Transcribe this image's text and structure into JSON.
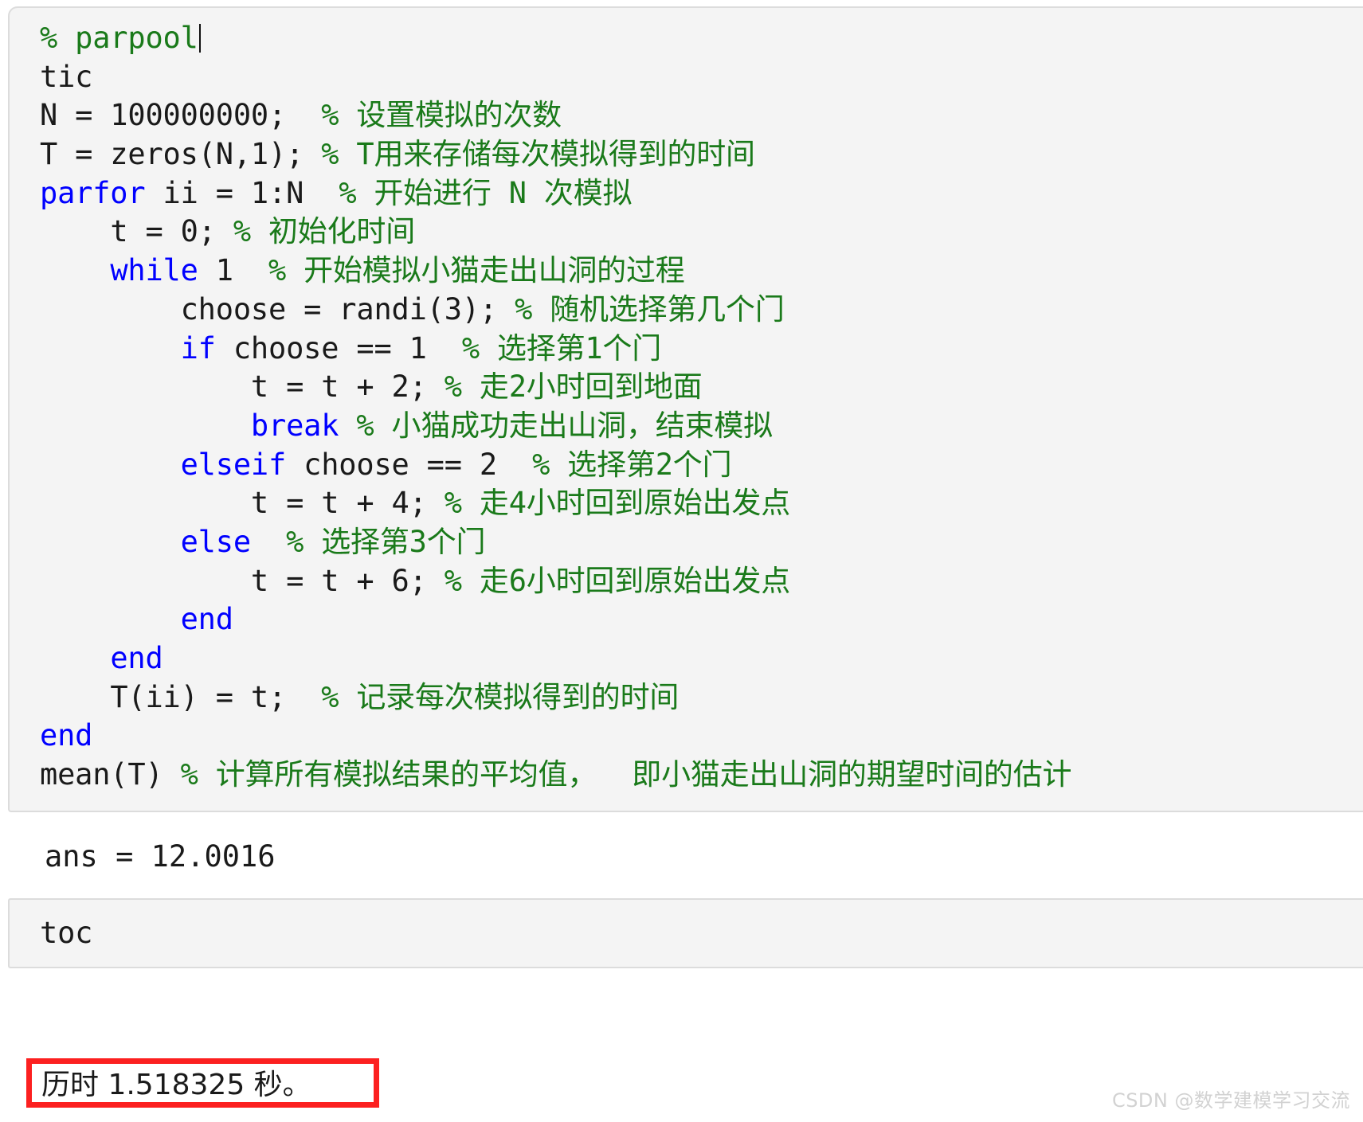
{
  "code_cell": {
    "name": "matlab-code-cell",
    "lines": [
      {
        "indent": 0,
        "tokens": [
          {
            "t": "cmt",
            "s": "% parpool"
          }
        ],
        "cursor": true
      },
      {
        "indent": 0,
        "tokens": [
          {
            "t": "plain",
            "s": "tic"
          }
        ]
      },
      {
        "indent": 0,
        "tokens": [
          {
            "t": "plain",
            "s": "N = 100000000;  "
          },
          {
            "t": "cmt",
            "s": "% 设置模拟的次数"
          }
        ]
      },
      {
        "indent": 0,
        "tokens": [
          {
            "t": "plain",
            "s": "T = zeros(N,1); "
          },
          {
            "t": "cmt",
            "s": "% T用来存储每次模拟得到的时间"
          }
        ]
      },
      {
        "indent": 0,
        "tokens": [
          {
            "t": "kw",
            "s": "parfor"
          },
          {
            "t": "plain",
            "s": " ii = 1:N  "
          },
          {
            "t": "cmt",
            "s": "% 开始进行 N 次模拟"
          }
        ]
      },
      {
        "indent": 1,
        "tokens": [
          {
            "t": "plain",
            "s": "t = 0; "
          },
          {
            "t": "cmt",
            "s": "% 初始化时间"
          }
        ]
      },
      {
        "indent": 1,
        "tokens": [
          {
            "t": "kw",
            "s": "while"
          },
          {
            "t": "plain",
            "s": " 1  "
          },
          {
            "t": "cmt",
            "s": "% 开始模拟小猫走出山洞的过程"
          }
        ]
      },
      {
        "indent": 2,
        "tokens": [
          {
            "t": "plain",
            "s": "choose = randi(3); "
          },
          {
            "t": "cmt",
            "s": "% 随机选择第几个门"
          }
        ]
      },
      {
        "indent": 2,
        "tokens": [
          {
            "t": "kw",
            "s": "if"
          },
          {
            "t": "plain",
            "s": " choose == 1  "
          },
          {
            "t": "cmt",
            "s": "% 选择第1个门"
          }
        ]
      },
      {
        "indent": 3,
        "tokens": [
          {
            "t": "plain",
            "s": "t = t + 2; "
          },
          {
            "t": "cmt",
            "s": "% 走2小时回到地面"
          }
        ]
      },
      {
        "indent": 3,
        "tokens": [
          {
            "t": "kw",
            "s": "break"
          },
          {
            "t": "plain",
            "s": " "
          },
          {
            "t": "cmt",
            "s": "% 小猫成功走出山洞，结束模拟"
          }
        ]
      },
      {
        "indent": 2,
        "tokens": [
          {
            "t": "kw",
            "s": "elseif"
          },
          {
            "t": "plain",
            "s": " choose == 2  "
          },
          {
            "t": "cmt",
            "s": "% 选择第2个门"
          }
        ]
      },
      {
        "indent": 3,
        "tokens": [
          {
            "t": "plain",
            "s": "t = t + 4; "
          },
          {
            "t": "cmt",
            "s": "% 走4小时回到原始出发点"
          }
        ]
      },
      {
        "indent": 2,
        "tokens": [
          {
            "t": "kw",
            "s": "else"
          },
          {
            "t": "plain",
            "s": "  "
          },
          {
            "t": "cmt",
            "s": "% 选择第3个门"
          }
        ]
      },
      {
        "indent": 3,
        "tokens": [
          {
            "t": "plain",
            "s": "t = t + 6; "
          },
          {
            "t": "cmt",
            "s": "% 走6小时回到原始出发点"
          }
        ]
      },
      {
        "indent": 2,
        "tokens": [
          {
            "t": "kw",
            "s": "end"
          }
        ]
      },
      {
        "indent": 1,
        "tokens": [
          {
            "t": "kw",
            "s": "end"
          }
        ]
      },
      {
        "indent": 1,
        "tokens": [
          {
            "t": "plain",
            "s": "T(ii) = t;  "
          },
          {
            "t": "cmt",
            "s": "% 记录每次模拟得到的时间"
          }
        ]
      },
      {
        "indent": 0,
        "tokens": [
          {
            "t": "kw",
            "s": "end"
          }
        ]
      },
      {
        "indent": 0,
        "tokens": [
          {
            "t": "plain",
            "s": "mean(T) "
          },
          {
            "t": "cmt",
            "s": "% 计算所有模拟结果的平均值，  即小猫走出山洞的期望时间的估计"
          }
        ]
      }
    ]
  },
  "ans_output": {
    "text": "ans = 12.0016"
  },
  "code_cell_2": {
    "name": "toc-code-cell",
    "lines": [
      {
        "indent": 0,
        "tokens": [
          {
            "t": "plain",
            "s": "toc"
          }
        ]
      }
    ]
  },
  "elapsed_output": {
    "text": "历时 1.518325 秒。",
    "highlight_color": "#fc2020"
  },
  "watermark": {
    "text": "CSDN @数学建模学习交流"
  },
  "colors": {
    "keyword": "#0000ff",
    "comment": "#1a7a1a",
    "plain": "#1a1a1a",
    "cell_background": "#f4f4f4",
    "cell_border": "#dcdcdc",
    "highlight": "#fc2020"
  }
}
